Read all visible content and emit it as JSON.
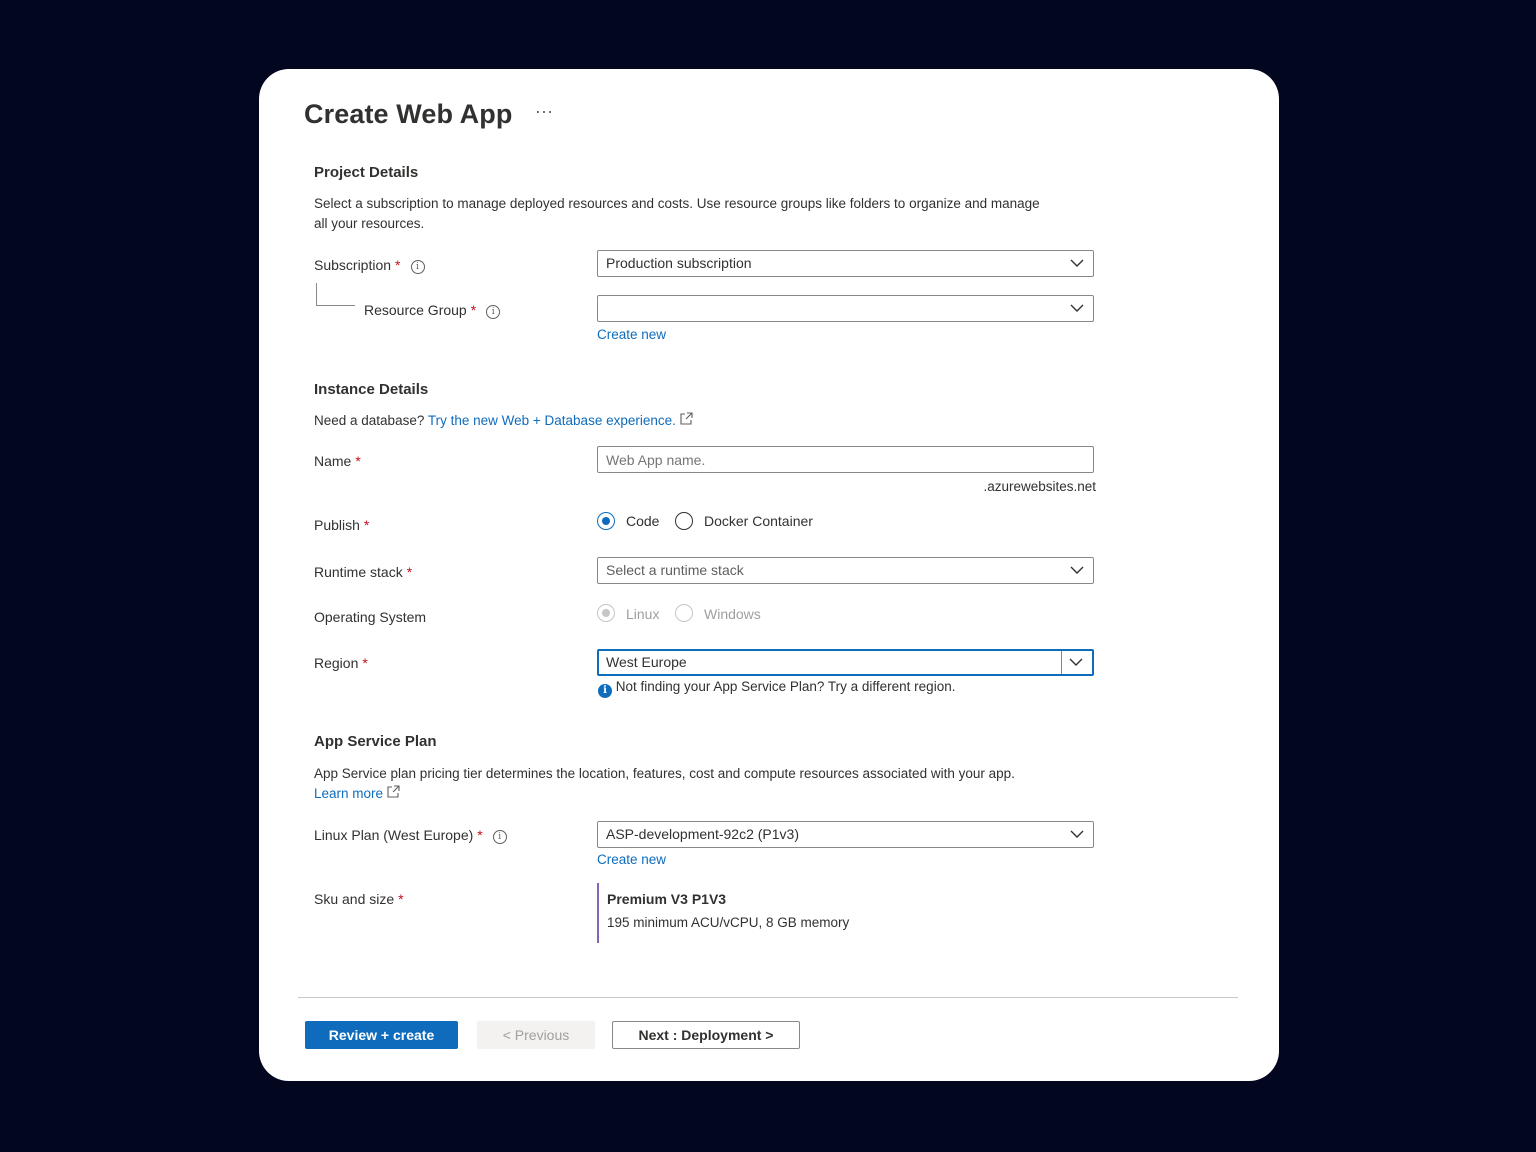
{
  "header": {
    "title": "Create Web App",
    "more": "···"
  },
  "project_details": {
    "heading": "Project Details",
    "description_line1": "Select a subscription to manage deployed resources and costs. Use resource groups like folders to organize and manage",
    "description_line2": "all your resources.",
    "subscription": {
      "label": "Subscription",
      "value": "Production subscription"
    },
    "resource_group": {
      "label": "Resource Group",
      "value": "",
      "create_new": "Create new"
    }
  },
  "instance_details": {
    "heading": "Instance Details",
    "db_prompt": "Need a database?",
    "db_link": "Try the new Web + Database experience.",
    "name": {
      "label": "Name",
      "placeholder": "Web App name.",
      "suffix": ".azurewebsites.net"
    },
    "publish": {
      "label": "Publish",
      "options": [
        "Code",
        "Docker Container"
      ],
      "selected": "Code"
    },
    "runtime": {
      "label": "Runtime stack",
      "placeholder": "Select a runtime stack"
    },
    "os": {
      "label": "Operating System",
      "options": [
        "Linux",
        "Windows"
      ],
      "selected": "Linux",
      "disabled": true
    },
    "region": {
      "label": "Region",
      "value": "West Europe",
      "hint": "Not finding your App Service Plan? Try a different region."
    }
  },
  "app_service_plan": {
    "heading": "App Service Plan",
    "description": "App Service plan pricing tier determines the location, features, cost and compute resources associated with your app.",
    "learn_more": "Learn more",
    "linux_plan": {
      "label": "Linux Plan (West Europe)",
      "value": "ASP-development-92c2 (P1v3)",
      "create_new": "Create new"
    },
    "sku": {
      "label": "Sku and size",
      "tier": "Premium V3 P1V3",
      "details": "195 minimum ACU/vCPU, 8 GB memory"
    }
  },
  "footer": {
    "review_create": "Review + create",
    "previous": "< Previous",
    "next": "Next : Deployment >"
  },
  "colors": {
    "accent": "#0f6cbd",
    "required": "#c50f1f",
    "background": "#03061f",
    "sku_bar": "#8764b8"
  }
}
